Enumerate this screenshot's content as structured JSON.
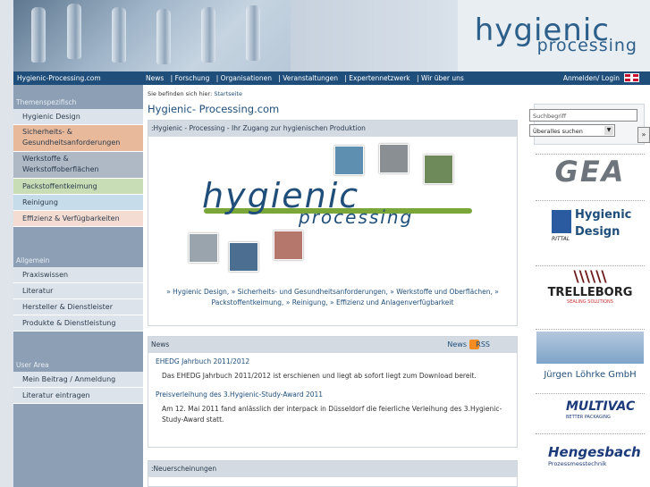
{
  "header": {
    "logo_line1": "hygienic",
    "logo_line2": "processing"
  },
  "topnav": {
    "brand": "Hygienic-Processing.com",
    "links": [
      "News",
      "| Forschung",
      "| Organisationen",
      "| Veranstaltungen",
      "| Expertennetzwerk",
      "| Wir über uns"
    ],
    "login": "Anmelden/ Login",
    "flag_icon": "uk-flag-icon"
  },
  "sidebar": {
    "section1_title": "Themenspezifisch",
    "section1_items": [
      {
        "label": "Hygienic Design",
        "bg": "#dde3ea"
      },
      {
        "label": "Sicherheits- &\nGesundheitsanforderungen",
        "bg": "#e8b99a"
      },
      {
        "label": "Werkstoffe &\nWerkstoffoberflächen",
        "bg": "#aeb9c5"
      },
      {
        "label": "Packstoffentkeimung",
        "bg": "#c8dcb5"
      },
      {
        "label": "Reinigung",
        "bg": "#c7dcea"
      },
      {
        "label": "Effizienz & Verfügbarkeiten",
        "bg": "#f4dcd2"
      }
    ],
    "section2_title": "Allgemein",
    "section2_items": [
      "Praxiswissen",
      "Literatur",
      "Hersteller & Dienstleister",
      "Produkte & Dienstleistung"
    ],
    "section3_title": "User Area",
    "section3_items": [
      "Mein Beitrag / Anmeldung",
      "Literatur eintragen"
    ]
  },
  "main": {
    "breadcrumb_prefix": "Sie befinden sich hier:",
    "breadcrumb_link": "Startseite",
    "page_title": "Hygienic- Processing.com",
    "intro_head": ":Hygienic - Processing - Ihr Zugang zur hygienischen Produktion",
    "hero_line1": "hygienic",
    "hero_line2": "processing",
    "hero_caption": "» Hygienic Design, » Sicherheits- und Gesundheitsanforderungen, » Werkstoffe und Oberflächen, » Packstoffentkeimung, » Reinigung, » Effizienz und Anlagenverfügbarkeit",
    "news_head": "News",
    "news_link_label": "News",
    "rss_label": "RSS",
    "news": [
      {
        "title": "EHEDG Jahrbuch 2011/2012",
        "text": "Das EHEDG Jahrbuch 2011/2012 ist erschienen und liegt ab sofort liegt zum Download bereit."
      },
      {
        "title": "Preisverleihung des 3.Hygienic-Study-Award 2011",
        "text": "Am 12. Mai 2011 fand anlässlich der interpack in Düsseldorf die feierliche Verleihung des 3.Hygienic-Study-Award statt."
      }
    ],
    "new_releases_head": ":Neuerscheinungen"
  },
  "search": {
    "placeholder": "Suchbegriff",
    "select_value": "Überalles suchen",
    "button_label": "»"
  },
  "ads": {
    "gea": "GEA",
    "hd_line1": "Hygienic",
    "hd_line2": "Design",
    "hd_sub": "RITTAL",
    "trelleborg": "TRELLEBORG",
    "trelleborg_sub": "SEALING SOLUTIONS",
    "jl": "Jürgen Löhrke GmbH",
    "multivac": "MULTIVAC",
    "multivac_sub": "BETTER PACKAGING",
    "hengesbach": "Hengesbach",
    "hengesbach_sub": "Prozessmesstechnik"
  }
}
